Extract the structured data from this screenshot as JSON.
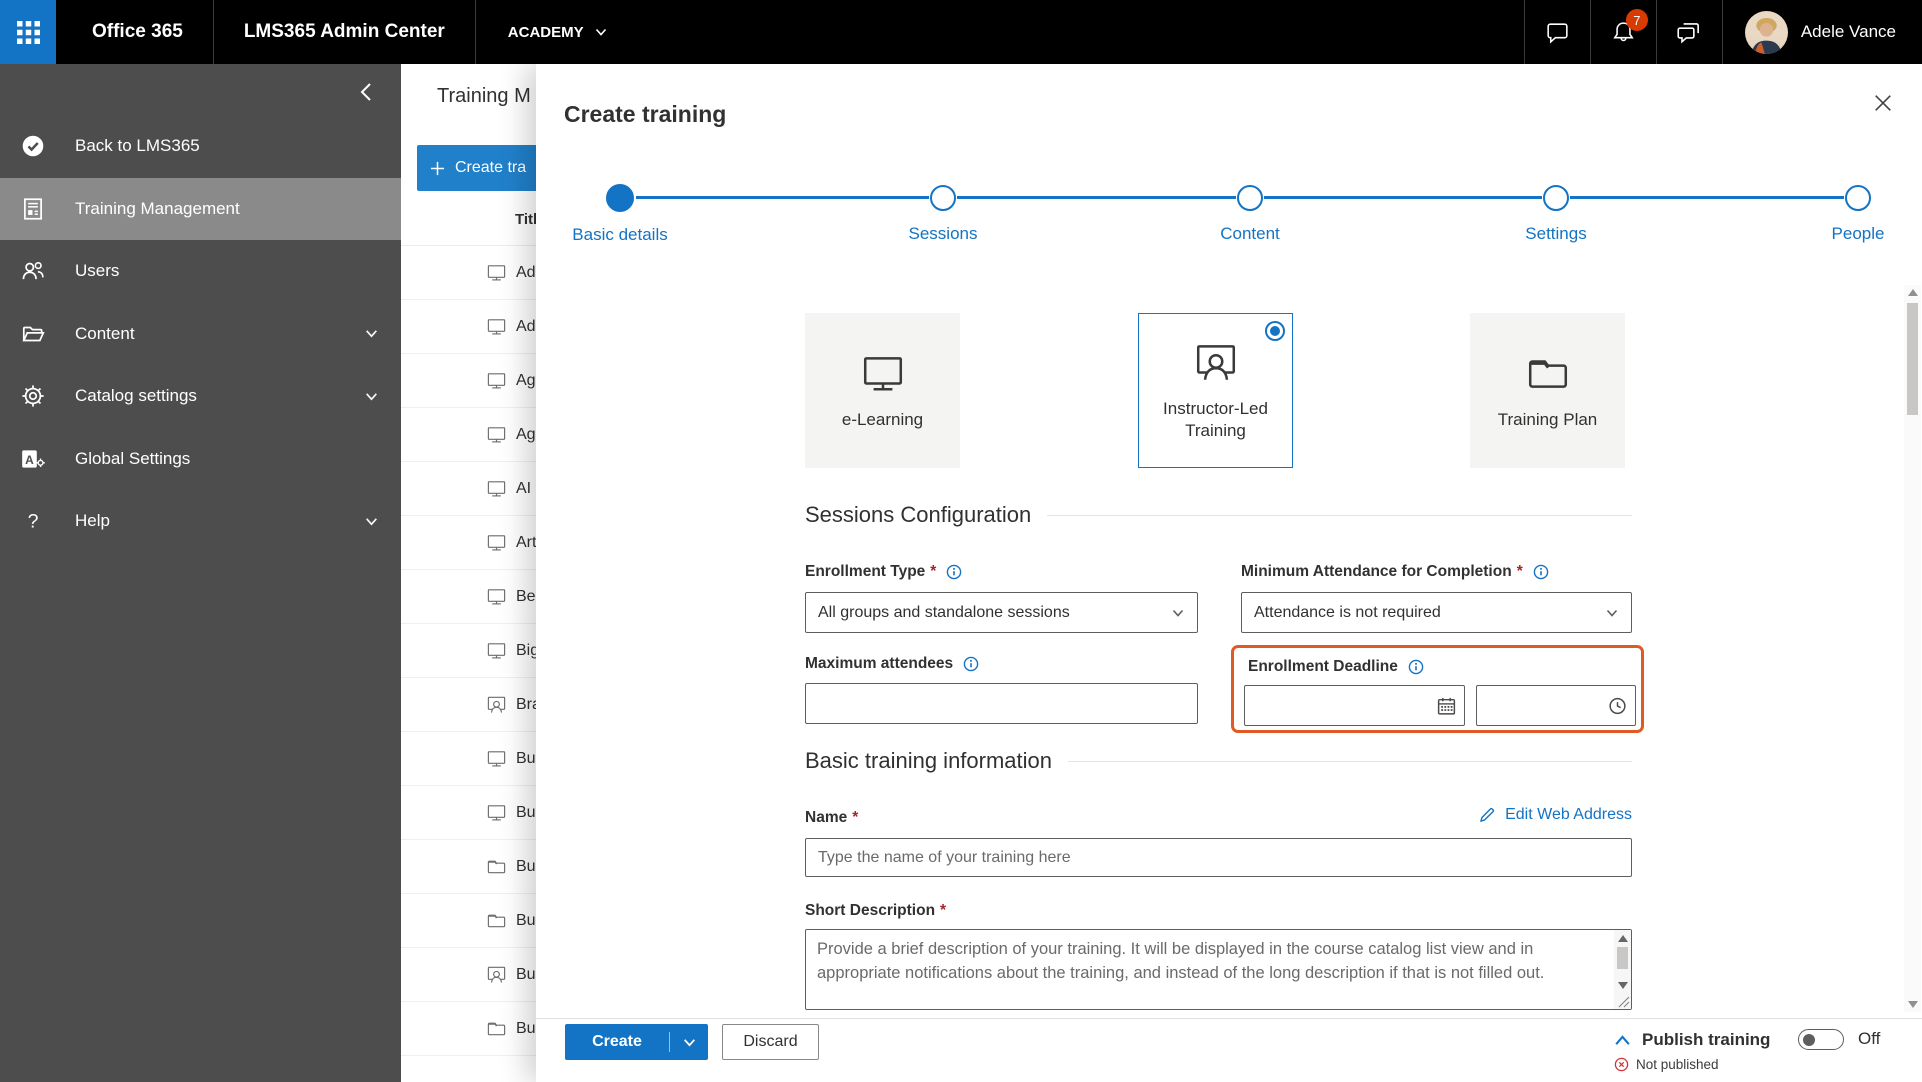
{
  "colors": {
    "accent_blue": "#1373c4",
    "topbar_bg": "#000000",
    "waffle_bg": "#1373c4",
    "sidebar_bg": "#4d4d4d",
    "sidebar_active_bg": "#8a8a8a",
    "highlight_orange": "#e05b24",
    "badge_red": "#d83b01",
    "required_red": "#a4262c",
    "not_published_red": "#d13438",
    "text_dark": "#323130",
    "field_border": "#605e5c",
    "card_bg": "#f4f4f3"
  },
  "icons": {
    "app_launcher": "waffle-grid",
    "tenant_expand": "chevron-down",
    "chat": "speech-bubble",
    "notifications": "bell",
    "feedback": "double-speech-bubble",
    "sidebar_collapse": "chevron-left",
    "back_to_lms365": "check-circle",
    "training_management": "document-list",
    "users": "people",
    "content": "open-folder",
    "catalog_settings": "gear",
    "global_settings": "a-with-gear",
    "help": "question-mark",
    "create": "plus",
    "close": "x",
    "info": "circled-i",
    "date_picker": "calendar",
    "time_picker": "clock",
    "edit_web_address": "pencil",
    "publish_expand": "chevron-up",
    "not_published": "circled-x",
    "elearning": "monitor",
    "instructor_led": "person-presenting",
    "training_plan": "folder"
  },
  "topbar": {
    "brand": "Office 365",
    "app_title": "LMS365 Admin Center",
    "tenant": "ACADEMY",
    "notification_count": "7",
    "user_name": "Adele Vance"
  },
  "sidebar": {
    "items": [
      {
        "label": "Back to LMS365",
        "icon": "check-circle",
        "active": false
      },
      {
        "label": "Training Management",
        "icon": "document-list",
        "active": true
      },
      {
        "label": "Users",
        "icon": "people",
        "active": false
      },
      {
        "label": "Content",
        "icon": "open-folder",
        "active": false,
        "expandable": true
      },
      {
        "label": "Catalog settings",
        "icon": "gear",
        "active": false,
        "expandable": true
      },
      {
        "label": "Global Settings",
        "icon": "a-with-gear",
        "active": false
      },
      {
        "label": "Help",
        "icon": "question-mark",
        "active": false,
        "expandable": true
      }
    ]
  },
  "background_list": {
    "page_title": "Training M",
    "create_button_label": "Create tra",
    "column_header": "Titl",
    "rows": [
      {
        "icon": "monitor",
        "text": "Ad"
      },
      {
        "icon": "monitor",
        "text": "Ad"
      },
      {
        "icon": "monitor",
        "text": "Ag"
      },
      {
        "icon": "monitor",
        "text": "Ag"
      },
      {
        "icon": "monitor",
        "text": "AI"
      },
      {
        "icon": "monitor",
        "text": "Art"
      },
      {
        "icon": "monitor",
        "text": "Be"
      },
      {
        "icon": "monitor",
        "text": "Big"
      },
      {
        "icon": "instructor",
        "text": "Bra"
      },
      {
        "icon": "monitor",
        "text": "Bu"
      },
      {
        "icon": "monitor",
        "text": "Bu"
      },
      {
        "icon": "folder",
        "text": "Bu"
      },
      {
        "icon": "folder",
        "text": "Bu"
      },
      {
        "icon": "instructor",
        "text": "Bu"
      },
      {
        "icon": "folder",
        "text": "Bu"
      }
    ]
  },
  "modal": {
    "title": "Create training",
    "steps": [
      {
        "label": "Basic details",
        "state": "current"
      },
      {
        "label": "Sessions",
        "state": "upcoming"
      },
      {
        "label": "Content",
        "state": "upcoming"
      },
      {
        "label": "Settings",
        "state": "upcoming"
      },
      {
        "label": "People",
        "state": "upcoming"
      }
    ],
    "training_types": [
      {
        "label": "e-Learning",
        "icon": "monitor",
        "selected": false
      },
      {
        "label": "Instructor-Led Training",
        "icon": "person-presenting",
        "selected": true
      },
      {
        "label": "Training Plan",
        "icon": "folder",
        "selected": false
      }
    ],
    "sessions_configuration": {
      "heading": "Sessions Configuration",
      "enrollment_type": {
        "label": "Enrollment Type",
        "required_mark": "*",
        "value": "All groups and standalone sessions"
      },
      "minimum_attendance": {
        "label": "Minimum Attendance for Completion",
        "required_mark": "*",
        "value": "Attendance is not required"
      },
      "maximum_attendees": {
        "label": "Maximum attendees",
        "value": ""
      },
      "enrollment_deadline": {
        "label": "Enrollment Deadline",
        "date_value": "",
        "time_value": ""
      }
    },
    "basic_information": {
      "heading": "Basic training information",
      "name": {
        "label": "Name",
        "required_mark": "*",
        "value": "",
        "placeholder": "Type the name of your training here"
      },
      "edit_web_address_label": "Edit Web Address",
      "short_description": {
        "label": "Short Description",
        "required_mark": "*",
        "value": "",
        "placeholder": "Provide a brief description of your training. It will be displayed in the course catalog list view and in appropriate notifications about the training, and instead of the long description if that is not filled out."
      }
    },
    "footer": {
      "create_label": "Create",
      "discard_label": "Discard",
      "publish_label": "Publish training",
      "publish_state_label": "Off",
      "publish_status": "Not published"
    }
  }
}
